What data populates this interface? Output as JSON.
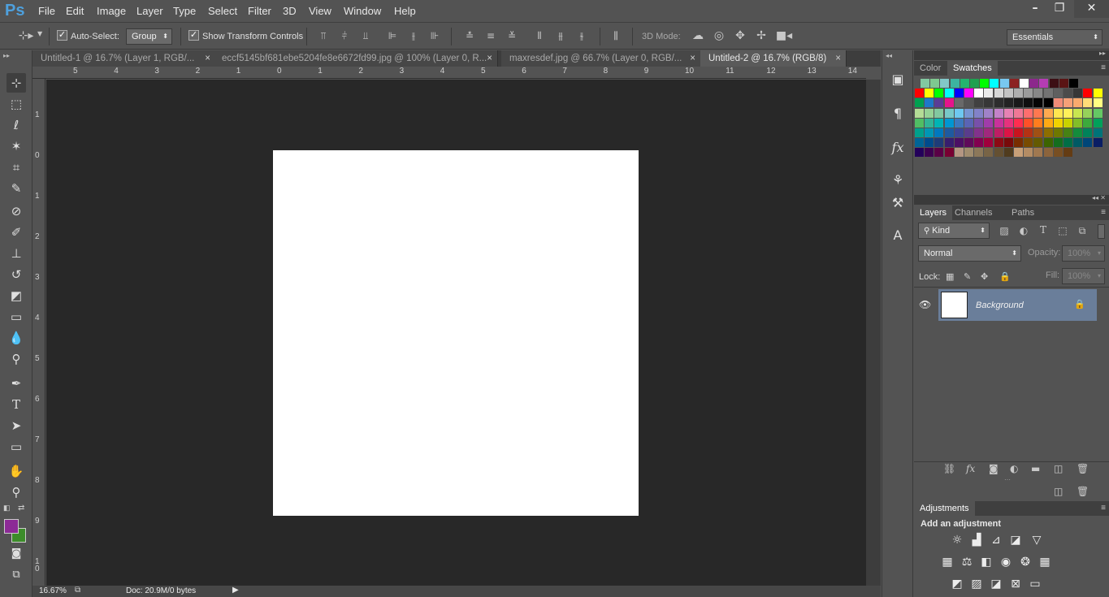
{
  "app": {
    "logo": "Ps"
  },
  "menu": {
    "items": [
      "File",
      "Edit",
      "Image",
      "Layer",
      "Type",
      "Select",
      "Filter",
      "3D",
      "View",
      "Window",
      "Help"
    ]
  },
  "window_controls": {
    "minimize": "–",
    "restore": "❐",
    "close": "✕"
  },
  "options": {
    "auto_select_label": "Auto-Select:",
    "auto_select_checked": "✓",
    "auto_select_value": "Group",
    "show_transform_label": "Show Transform Controls",
    "show_transform_checked": "✓",
    "mode_3d_label": "3D Mode:",
    "workspace": "Essentials"
  },
  "tabs": [
    {
      "label": "Untitled-1 @ 16.7% (Layer 1, RGB/...",
      "close": "×"
    },
    {
      "label": "eccf5145bf681ebe5204fe8e6672fd99.jpg @ 100% (Layer 0, R...",
      "close": "×"
    },
    {
      "label": "maxresdef.jpg @ 66.7% (Layer 0, RGB/...",
      "close": "×"
    },
    {
      "label": "Untitled-2 @ 16.7% (RGB/8)",
      "close": "×"
    }
  ],
  "ruler": {
    "h": [
      "5",
      "4",
      "3",
      "2",
      "1",
      "0",
      "1",
      "2",
      "3",
      "4",
      "5",
      "6",
      "7",
      "8",
      "9",
      "10",
      "11",
      "12",
      "13",
      "14"
    ],
    "v": [
      "1",
      "0",
      "1",
      "2",
      "3",
      "4",
      "5",
      "6",
      "7",
      "8",
      "9",
      "1 0"
    ]
  },
  "status": {
    "zoom": "16.67%",
    "doc": "Doc: 20.9M/0 bytes"
  },
  "color_panel": {
    "tabs": [
      "Color",
      "Swatches"
    ],
    "active": "Swatches"
  },
  "swatch_colors": [
    [
      "#82c8a0",
      "#7ec890",
      "#82c8c8",
      "#3cb4a0",
      "#23b46e",
      "#1ea050",
      "#00ff00",
      "#00ffff",
      "#78c8f0",
      "#8c2323",
      "#ffffff",
      "#8c288c",
      "#b43cb4",
      "#3c0f14",
      "#5a1414",
      "#000000"
    ],
    [
      "#ff0000",
      "#ffff00",
      "#00ff00",
      "#00ffff",
      "#0000ff",
      "#ff00ff",
      "#ffffff",
      "#ebebeb",
      "#d7d7d7",
      "#c3c3c3",
      "#afafaf",
      "#9b9b9b",
      "#878787",
      "#737373",
      "#5f5f5f",
      "#4b4b4b",
      "#373737",
      "#ff0000",
      "#ffff00"
    ],
    [
      "#00a050",
      "#1e78c8",
      "#5a3c96",
      "#e6148c",
      "#696969",
      "#555555",
      "#414141",
      "#373737",
      "#2d2d2d",
      "#232323",
      "#191919",
      "#0f0f0f",
      "#050505",
      "#000000",
      "#f08c78",
      "#f5a078",
      "#faaa6e",
      "#ffdc78",
      "#ffff82"
    ],
    [
      "#b4dc96",
      "#96d296",
      "#82c8a0",
      "#78c8c8",
      "#6ec8f0",
      "#7896d2",
      "#8282c8",
      "#a082c8",
      "#c382c8",
      "#e682b4",
      "#f07896",
      "#ff6e6e",
      "#ff7850",
      "#ffaa50",
      "#ffe650",
      "#fff05a",
      "#c8e650",
      "#96d25a",
      "#64c864"
    ],
    [
      "#50be64",
      "#32b496",
      "#00b4b4",
      "#0096d2",
      "#3c78be",
      "#5a64b4",
      "#7850aa",
      "#a03caa",
      "#c8329b",
      "#e6327d",
      "#ff2d50",
      "#ff5028",
      "#ff7d1e",
      "#ffaa14",
      "#f0d200",
      "#c8d200",
      "#82be28",
      "#3caa3c",
      "#00a05a"
    ],
    [
      "#00a08c",
      "#0096b4",
      "#0078be",
      "#1e5aa0",
      "#3c4696",
      "#5a3c8c",
      "#82328c",
      "#a0287d",
      "#be1e64",
      "#dc1446",
      "#c8141e",
      "#b43214",
      "#a05014",
      "#8c6e00",
      "#6e7800",
      "#468214",
      "#148c3c",
      "#00825a",
      "#007378"
    ],
    [
      "#006496",
      "#004b8c",
      "#1e3c78",
      "#371e6e",
      "#4b0f64",
      "#5f0a5a",
      "#820050",
      "#a0003c",
      "#8c0a14",
      "#780a0a",
      "#782d00",
      "#784b00",
      "#645a00",
      "#3c6400",
      "#146e1e",
      "#006e46",
      "#005a64",
      "#004678",
      "#0a1e64"
    ],
    [
      "#23005a",
      "#3c0050",
      "#5a0046",
      "#780032",
      "#b49682",
      "#a08c6e",
      "#8c785a",
      "#786446",
      "#645032",
      "#503c1e",
      "#c8a078",
      "#b48c64",
      "#a07850",
      "#8c643c",
      "#784f23",
      "#643c14"
    ]
  ],
  "layers_panel": {
    "tabs": [
      "Layers",
      "Channels",
      "Paths"
    ],
    "active": "Layers",
    "kind_label": "Kind",
    "blend_mode": "Normal",
    "opacity_label": "Opacity:",
    "opacity_value": "100%",
    "lock_label": "Lock:",
    "fill_label": "Fill:",
    "fill_value": "100%",
    "layers": [
      {
        "name": "Background",
        "visible_icon": "eye-icon",
        "locked_icon": "lock-icon"
      }
    ]
  },
  "adjustments_panel": {
    "title": "Adjustments",
    "subtitle": "Add an adjustment"
  },
  "colors": {
    "foreground": "#8c2a96",
    "background": "#3c8c2a",
    "canvas_bg": "#282828",
    "accent": "#4ea0dd"
  }
}
